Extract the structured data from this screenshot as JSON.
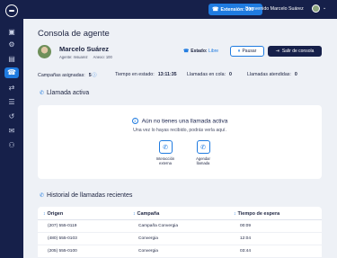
{
  "sidebar": {
    "items": [
      {
        "icon": "monitor-icon"
      },
      {
        "icon": "settings-icon"
      },
      {
        "icon": "chart-icon"
      },
      {
        "icon": "phone-icon",
        "active": true
      },
      {
        "icon": "transfer-icon"
      },
      {
        "icon": "list-icon"
      },
      {
        "icon": "history-icon"
      },
      {
        "icon": "chat-icon"
      },
      {
        "icon": "users-icon"
      }
    ]
  },
  "topbar": {
    "extension": "Extensión: 200",
    "welcome": "Bienvenido Marcelo Suárez"
  },
  "page": {
    "title": "Consola de agente"
  },
  "agent": {
    "name": "Marcelo Suárez",
    "role_line": "Agente: msuarez",
    "extension_line": "Anexo: 100",
    "status_label": "Estado:",
    "status_value": "Libre",
    "pause_label": "Pausar",
    "exit_label": "Salir de consola"
  },
  "stats": {
    "assigned_label": "Campañas asignadas:",
    "assigned_value": "5",
    "time_label": "Tiempo en estado:",
    "time_value": "13:11:35",
    "queue_label": "Llamadas en cola:",
    "queue_value": "0",
    "attended_label": "Llamadas atendidas:",
    "attended_value": "0"
  },
  "active_call": {
    "section_title": "Llamada activa",
    "empty_title": "Aún no tienes una llamada activa",
    "empty_subtitle": "Una vez lo hayas recibido, podrás verla aquí.",
    "actions": [
      {
        "label_1": "Interacción",
        "label_2": "externa"
      },
      {
        "label_1": "Agendar",
        "label_2": "llamada"
      }
    ]
  },
  "history": {
    "section_title": "Historial de llamadas recientes",
    "columns": [
      "Origen",
      "Campaña",
      "Tiempo de espera"
    ],
    "rows": [
      [
        "(207) 555-0119",
        "Campaña Convergia",
        "00:09"
      ],
      [
        "(480) 555-0103",
        "Convergia",
        "12:04"
      ],
      [
        "(205) 555-0100",
        "Convergia",
        "03:44"
      ]
    ]
  },
  "colors": {
    "navy": "#16204a",
    "accent": "#1f7be0",
    "background": "#eef1f6"
  }
}
